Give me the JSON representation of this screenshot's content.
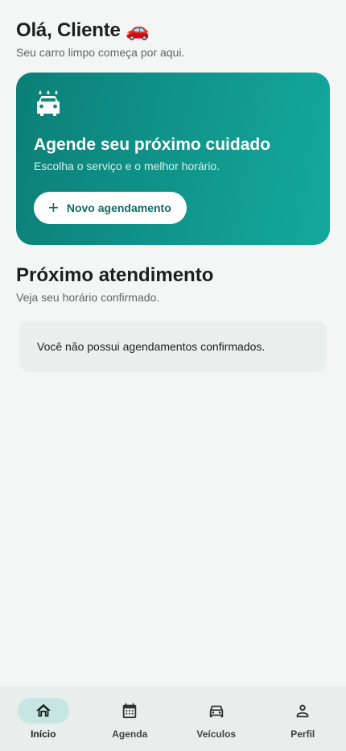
{
  "greeting": {
    "title": "Olá, Cliente 🚗",
    "subtitle": "Seu carro limpo começa por aqui."
  },
  "hero": {
    "icon": "car-wash-icon",
    "title": "Agende seu próximo cuidado",
    "subtitle": "Escolha o serviço e o melhor horário.",
    "button_label": "Novo agendamento",
    "colors": {
      "gradient_start": "#0c7f77",
      "gradient_end": "#14a99d"
    }
  },
  "next_appointment": {
    "title": "Próximo atendimento",
    "subtitle": "Veja seu horário confirmado.",
    "empty_message": "Você não possui agendamentos confirmados."
  },
  "bottom_nav": {
    "items": [
      {
        "label": "Início",
        "icon": "home-icon",
        "active": true
      },
      {
        "label": "Agenda",
        "icon": "calendar-icon",
        "active": false
      },
      {
        "label": "Veículos",
        "icon": "car-icon",
        "active": false
      },
      {
        "label": "Perfil",
        "icon": "person-icon",
        "active": false
      }
    ]
  }
}
